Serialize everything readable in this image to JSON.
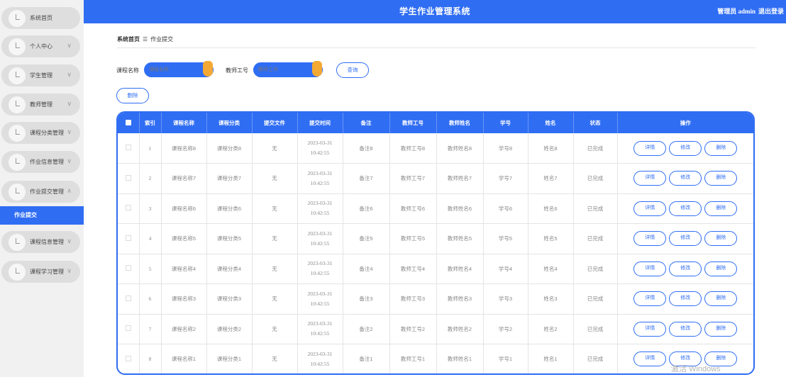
{
  "header": {
    "title": "学生作业管理系统",
    "user": "管理员 admin",
    "logout": "退出登录"
  },
  "sidebar": {
    "items": [
      {
        "label": "系统首页",
        "chevron": ""
      },
      {
        "label": "个人中心",
        "chevron": "∨"
      },
      {
        "label": "学生管理",
        "chevron": "∨"
      },
      {
        "label": "教师管理",
        "chevron": "∨"
      },
      {
        "label": "课程分类管理",
        "chevron": "∨"
      },
      {
        "label": "作业信息管理",
        "chevron": "∨"
      },
      {
        "label": "作业提交管理",
        "chevron": "∧"
      },
      {
        "label": "课程信息管理",
        "chevron": "∨"
      },
      {
        "label": "课程学习管理",
        "chevron": "∨"
      }
    ],
    "active_sub": "作业提交"
  },
  "breadcrumb": {
    "home": "系统首页",
    "sep": "☰",
    "current": "作业提交"
  },
  "search": {
    "course_label": "课程名称",
    "course_placeholder": "课程名称",
    "teacher_label": "教师工号",
    "teacher_placeholder": "教师工号",
    "query_button": "查询"
  },
  "toolbar": {
    "delete_button": "删除"
  },
  "table": {
    "columns": [
      "索引",
      "课程名称",
      "课程分类",
      "提交文件",
      "提交时间",
      "备注",
      "教师工号",
      "教师姓名",
      "学号",
      "姓名",
      "状态",
      "操作"
    ],
    "actions": {
      "detail": "详情",
      "edit": "修改",
      "delete": "删除"
    },
    "rows": [
      {
        "index": "1",
        "course": "课程名称8",
        "category": "课程分类8",
        "file": "无",
        "time": "2023-03-31 10:42:55",
        "note": "备注8",
        "teacher_id": "教师工号8",
        "teacher_name": "教师姓名8",
        "student_id": "学号8",
        "name": "姓名8",
        "status": "已完成"
      },
      {
        "index": "2",
        "course": "课程名称7",
        "category": "课程分类7",
        "file": "无",
        "time": "2023-03-31 10:42:55",
        "note": "备注7",
        "teacher_id": "教师工号7",
        "teacher_name": "教师姓名7",
        "student_id": "学号7",
        "name": "姓名7",
        "status": "已完成"
      },
      {
        "index": "3",
        "course": "课程名称6",
        "category": "课程分类6",
        "file": "无",
        "time": "2023-03-31 10:42:55",
        "note": "备注6",
        "teacher_id": "教师工号6",
        "teacher_name": "教师姓名6",
        "student_id": "学号6",
        "name": "姓名6",
        "status": "已完成"
      },
      {
        "index": "4",
        "course": "课程名称5",
        "category": "课程分类5",
        "file": "无",
        "time": "2023-03-31 10:42:55",
        "note": "备注5",
        "teacher_id": "教师工号5",
        "teacher_name": "教师姓名5",
        "student_id": "学号5",
        "name": "姓名5",
        "status": "已完成"
      },
      {
        "index": "5",
        "course": "课程名称4",
        "category": "课程分类4",
        "file": "无",
        "time": "2023-03-31 10:42:55",
        "note": "备注4",
        "teacher_id": "教师工号4",
        "teacher_name": "教师姓名4",
        "student_id": "学号4",
        "name": "姓名4",
        "status": "已完成"
      },
      {
        "index": "6",
        "course": "课程名称3",
        "category": "课程分类3",
        "file": "无",
        "time": "2023-03-31 10:42:55",
        "note": "备注3",
        "teacher_id": "教师工号3",
        "teacher_name": "教师姓名3",
        "student_id": "学号3",
        "name": "姓名3",
        "status": "已完成"
      },
      {
        "index": "7",
        "course": "课程名称2",
        "category": "课程分类2",
        "file": "无",
        "time": "2023-03-31 10:42:55",
        "note": "备注2",
        "teacher_id": "教师工号2",
        "teacher_name": "教师姓名2",
        "student_id": "学号2",
        "name": "姓名2",
        "status": "已完成"
      },
      {
        "index": "8",
        "course": "课程名称1",
        "category": "课程分类1",
        "file": "无",
        "time": "2023-03-31 10:42:55",
        "note": "备注1",
        "teacher_id": "教师工号1",
        "teacher_name": "教师姓名1",
        "student_id": "学号1",
        "name": "姓名1",
        "status": "已完成"
      }
    ]
  },
  "watermark": "激活 Windows",
  "colors": {
    "primary": "#2f6df3",
    "accent": "#f4a935",
    "sidebar_bg": "#f1f1f1",
    "menu_item_bg": "#dedede"
  }
}
